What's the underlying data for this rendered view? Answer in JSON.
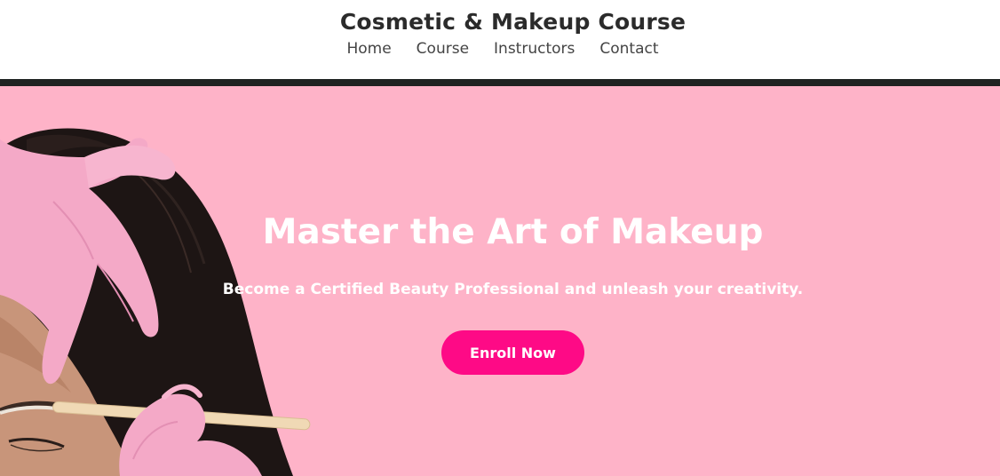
{
  "header": {
    "title": "Cosmetic & Makeup Course",
    "nav": [
      {
        "label": "Home"
      },
      {
        "label": "Course"
      },
      {
        "label": "Instructors"
      },
      {
        "label": "Contact"
      }
    ]
  },
  "hero": {
    "title": "Master the Art of Makeup",
    "subtitle": "Become a Certified Beauty Professional and unleash your creativity.",
    "cta_label": "Enroll Now",
    "image_subject": "makeup-artist-eyebrow-treatment-photo"
  },
  "colors": {
    "hero_background": "#feb3c8",
    "divider": "#1f2322",
    "button": "#fe0a86",
    "title_text": "#2b2b2b",
    "nav_text": "#444444"
  }
}
